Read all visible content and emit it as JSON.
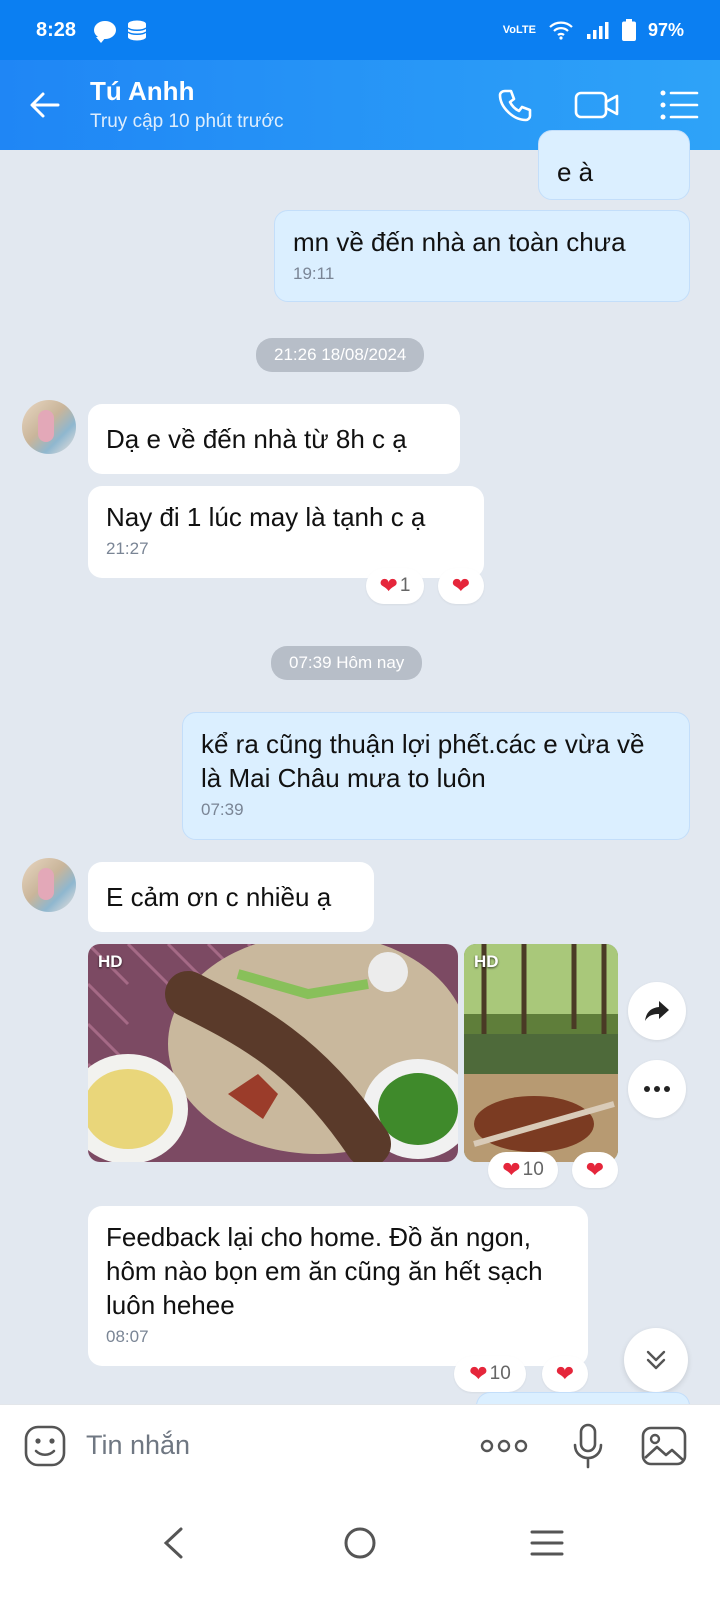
{
  "status_bar": {
    "time": "8:28",
    "network": "VoLTE",
    "battery": "97%"
  },
  "header": {
    "name": "Tú Anhh",
    "status": "Truy cập 10 phút trước"
  },
  "messages": {
    "m0": {
      "text": "e à"
    },
    "m1": {
      "text": "mn về đến nhà an toàn chưa",
      "time": "19:11"
    },
    "date1": "21:26 18/08/2024",
    "m2": {
      "text": "Dạ e về đến nhà từ 8h c ạ"
    },
    "m3": {
      "text": "Nay đi 1 lúc may là tạnh c ạ",
      "time": "21:27",
      "reaction_count": "1"
    },
    "date2": "07:39 Hôm nay",
    "m4": {
      "text": "kể ra cũng thuận lợi phết.các e vừa về là Mai Châu mưa to luôn",
      "time": "07:39"
    },
    "m5": {
      "text": "E cảm ơn c nhiều ạ"
    },
    "photos": {
      "hd1": "HD",
      "hd2": "HD",
      "reaction_count": "10"
    },
    "m6": {
      "text": "Feedback lại cho home. Đồ ăn ngon, hôm nào bọn em ăn cũng ăn hết sạch luôn hehee",
      "time": "08:07",
      "reaction_count": "10"
    }
  },
  "composer": {
    "placeholder": "Tin nhắn"
  },
  "colors": {
    "header": "#1f86f5",
    "outgoing_bubble": "#dbefff",
    "background": "#e2e8f0",
    "heart": "#e5263b"
  }
}
